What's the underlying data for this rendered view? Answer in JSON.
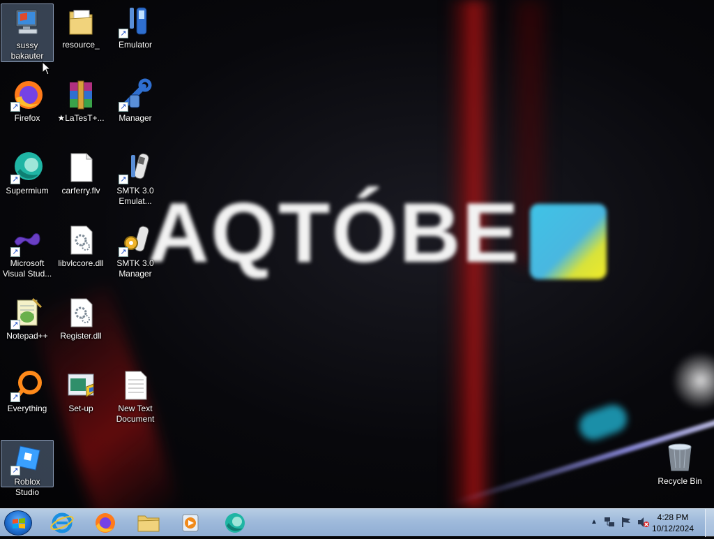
{
  "wallpaper": {
    "text": "AQTÓBE"
  },
  "desktop": {
    "icons": [
      {
        "label": "sussy bakauter",
        "icon": "computer-icon"
      },
      {
        "label": "resource_",
        "icon": "folder-icon"
      },
      {
        "label": "Emulator",
        "icon": "emulator-icon"
      },
      {
        "label": "Firefox",
        "icon": "firefox-icon"
      },
      {
        "label": "★LaTesT+...",
        "icon": "winrar-icon"
      },
      {
        "label": "Manager",
        "icon": "manager-icon"
      },
      {
        "label": "Supermium",
        "icon": "supermium-icon"
      },
      {
        "label": "carferry.flv",
        "icon": "file-icon"
      },
      {
        "label": "SMTK 3.0 Emulat...",
        "icon": "smtk-emulator-icon"
      },
      {
        "label": "Microsoft Visual Stud...",
        "icon": "visual-studio-icon"
      },
      {
        "label": "libvlccore.dll",
        "icon": "dll-icon"
      },
      {
        "label": "SMTK 3.0 Manager",
        "icon": "smtk-manager-icon"
      },
      {
        "label": "Notepad++",
        "icon": "notepadpp-icon"
      },
      {
        "label": "Register.dll",
        "icon": "dll-icon"
      },
      {
        "label": "Everything",
        "icon": "everything-icon"
      },
      {
        "label": "Set-up",
        "icon": "setup-icon"
      },
      {
        "label": "New Text Document",
        "icon": "text-document-icon"
      },
      {
        "label": "Roblox Studio",
        "icon": "roblox-studio-icon"
      },
      {
        "label": "Recycle Bin",
        "icon": "recycle-bin-icon"
      }
    ]
  },
  "taskbar": {
    "pinned": [
      "start-button",
      "internet-explorer",
      "firefox",
      "file-explorer",
      "media-player",
      "supermium"
    ],
    "tray": {
      "time": "4:28 PM",
      "date": "10/12/2024"
    }
  },
  "colors": {
    "taskbar": "#9fbadb",
    "start_orb": "#1f6fd1"
  }
}
